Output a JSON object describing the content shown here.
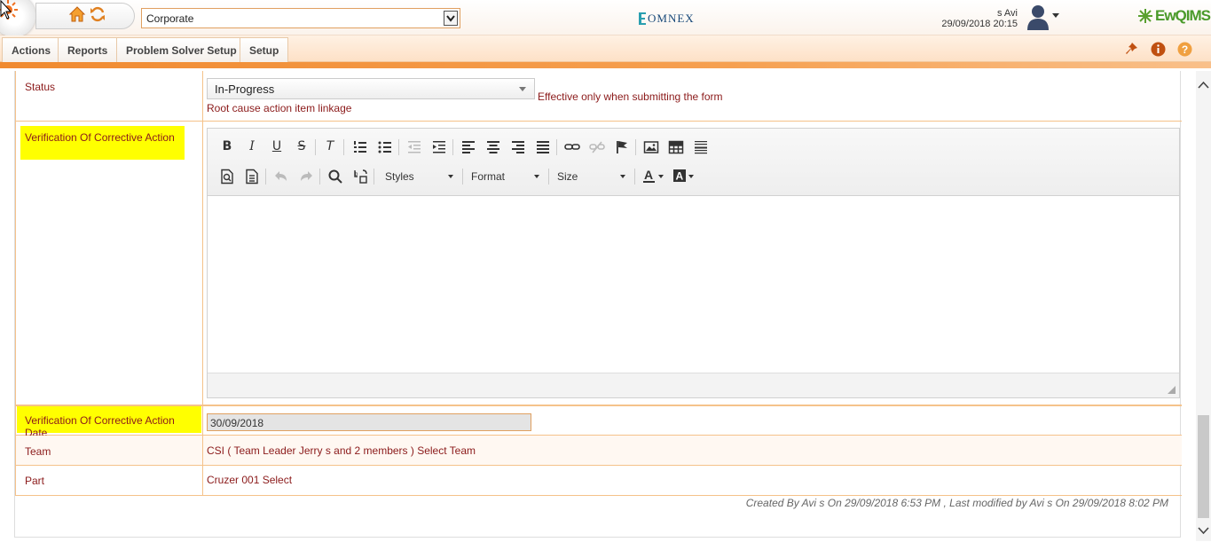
{
  "header": {
    "org_selected": "Corporate",
    "omnex_logo_text": "OMNEX",
    "user_name": "s Avi",
    "user_datetime": "29/09/2018 20:15",
    "product_logo_text": "EwQIMS"
  },
  "menu": {
    "items": [
      "Actions",
      "Reports",
      "Problem Solver Setup",
      "Setup"
    ]
  },
  "form": {
    "status": {
      "label": "Status",
      "value": "In-Progress",
      "note": "Effective only when submitting the form",
      "linkage": "Root cause action item linkage"
    },
    "verification": {
      "label": "Verification Of Corrective Action"
    },
    "editor": {
      "styles_label": "Styles",
      "format_label": "Format",
      "size_label": "Size"
    },
    "verification_date": {
      "label": "Verification Of Corrective Action Date",
      "value": "30/09/2018"
    },
    "team": {
      "label": "Team",
      "value": "CSI ( Team Leader Jerry s and 2 members ) Select Team"
    },
    "part": {
      "label": "Part",
      "value": "Cruzer 001 Select"
    }
  },
  "footer_note": "Created By Avi s On 29/09/2018 6:53 PM , Last modified by Avi s On 29/09/2018 8:02 PM",
  "colors": {
    "accent": "#f08a30",
    "label_text": "#8b1a1a",
    "highlight": "#ffff00"
  }
}
